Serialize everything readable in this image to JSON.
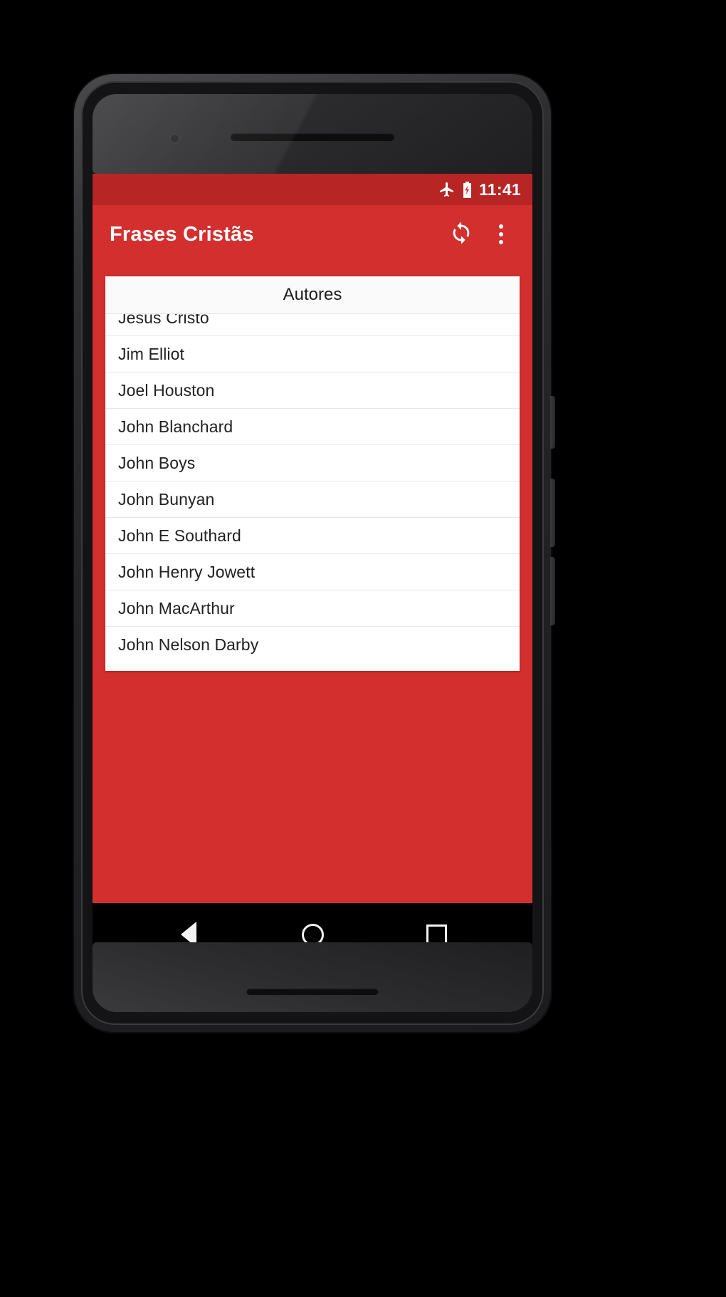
{
  "device": {
    "name": "android-phone",
    "nav_bar": {
      "back_label": "Back",
      "home_label": "Home",
      "recents_label": "Recents"
    }
  },
  "status_bar": {
    "time": "11:41",
    "icons": [
      "airplane-mode-icon",
      "battery-charging-icon"
    ]
  },
  "app_bar": {
    "title": "Frases Cristãs",
    "refresh_label": "Atualizar",
    "overflow_label": "Mais opções",
    "background_color": "#d32f2f"
  },
  "list": {
    "header": "Autores",
    "items": [
      {
        "name": "Jesus Cristo"
      },
      {
        "name": "Jim Elliot"
      },
      {
        "name": "Joel Houston"
      },
      {
        "name": "John Blanchard"
      },
      {
        "name": "John Boys"
      },
      {
        "name": "John Bunyan"
      },
      {
        "name": "John E Southard"
      },
      {
        "name": "John Henry Jowett"
      },
      {
        "name": "John MacArthur"
      },
      {
        "name": "John Nelson Darby"
      }
    ]
  },
  "theme": {
    "primary": "#d32f2f",
    "primary_dark": "#c62828",
    "surface": "#ffffff",
    "on_primary": "#ffffff",
    "text_primary": "#212121"
  }
}
